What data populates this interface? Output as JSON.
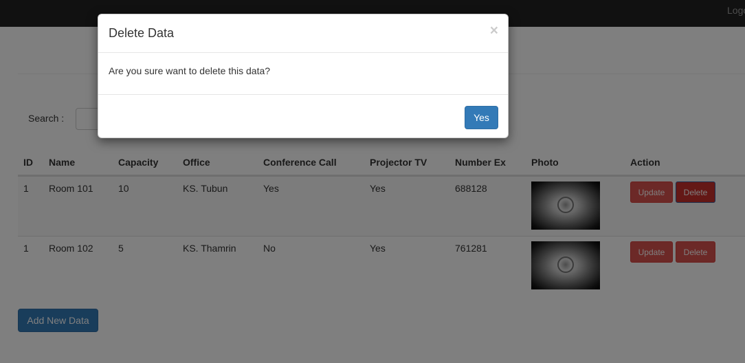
{
  "navbar": {
    "logout_label": "Logout"
  },
  "search": {
    "label": "Search :",
    "value": ""
  },
  "table": {
    "headers": [
      "ID",
      "Name",
      "Capacity",
      "Office",
      "Conference Call",
      "Projector TV",
      "Number Ex",
      "Photo",
      "Action"
    ],
    "rows": [
      {
        "id": "1",
        "name": "Room 101",
        "capacity": "10",
        "office": "KS. Tubun",
        "conference_call": "Yes",
        "projector_tv": "Yes",
        "number_ex": "688128",
        "update_label": "Update",
        "delete_label": "Delete"
      },
      {
        "id": "1",
        "name": "Room 102",
        "capacity": "5",
        "office": "KS. Thamrin",
        "conference_call": "No",
        "projector_tv": "Yes",
        "number_ex": "761281",
        "update_label": "Update",
        "delete_label": "Delete"
      }
    ]
  },
  "add_button_label": "Add New Data",
  "modal": {
    "title": "Delete Data",
    "close_symbol": "×",
    "message": "Are you sure want to delete this data?",
    "confirm_label": "Yes"
  },
  "colors": {
    "navbar": "#222222",
    "danger": "#d9534f",
    "primary": "#337ab7"
  }
}
